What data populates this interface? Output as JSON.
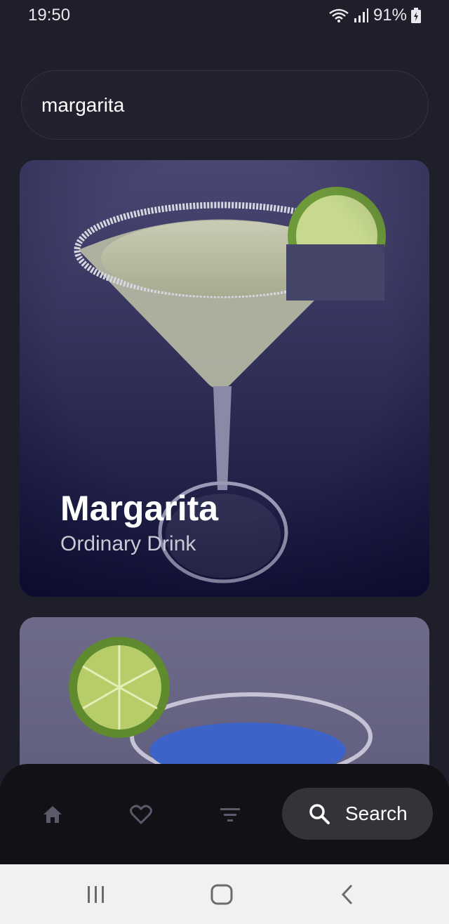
{
  "status_bar": {
    "time": "19:50",
    "battery": "91%"
  },
  "search": {
    "query": "margarita"
  },
  "results": [
    {
      "title": "Margarita",
      "category": "Ordinary Drink"
    }
  ],
  "bottom_nav": {
    "search_label": "Search"
  },
  "icons": {
    "home": "home-icon",
    "favorites": "heart-icon",
    "filter": "filter-icon",
    "search": "search-icon",
    "recents": "recents-icon",
    "home_button": "home-button-icon",
    "back": "back-icon"
  }
}
